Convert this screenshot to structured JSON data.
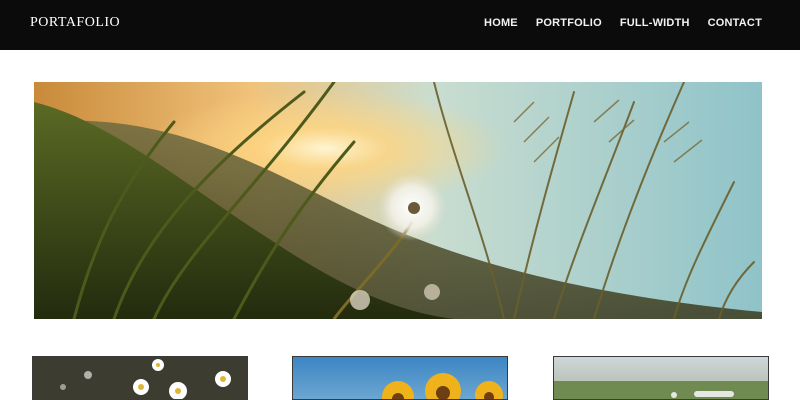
{
  "header": {
    "brand": "PORTAFOLIO",
    "nav": [
      {
        "label": "HOME"
      },
      {
        "label": "PORTFOLIO"
      },
      {
        "label": "FULL-WIDTH"
      },
      {
        "label": "CONTACT"
      }
    ]
  },
  "colors": {
    "navbar_background": "#0b0b0b",
    "nav_text": "#f2f2f2",
    "page_background": "#ffffff"
  }
}
